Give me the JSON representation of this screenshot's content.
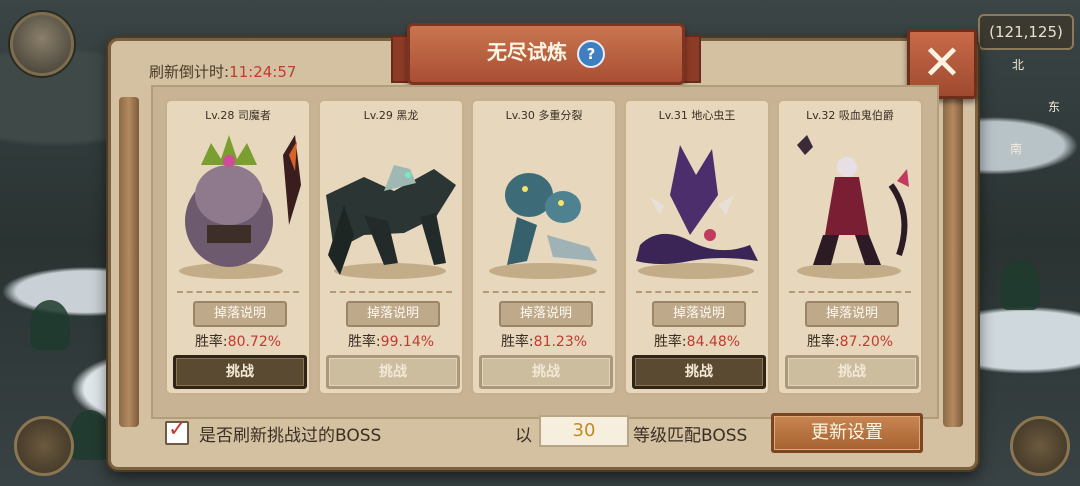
{
  "hud": {
    "coordinates": "(121,125)",
    "compass_north": "北",
    "compass_east": "东",
    "compass_south": "南"
  },
  "dialog": {
    "title": "无尽试炼",
    "help_icon": "?",
    "close_icon": "✕",
    "countdown_label": "刷新倒计时:",
    "countdown_value": "11:24:57"
  },
  "bosses": [
    {
      "level": "Lv.28",
      "name": "司魔者",
      "drop_label": "掉落说明",
      "winrate_label": "胜率:",
      "winrate": "80.72%",
      "challenge_label": "挑战",
      "enabled": true,
      "accent": "#7a9e2f"
    },
    {
      "level": "Lv.29",
      "name": "黑龙",
      "drop_label": "掉落说明",
      "winrate_label": "胜率:",
      "winrate": "99.14%",
      "challenge_label": "挑战",
      "enabled": false,
      "accent": "#2b3533"
    },
    {
      "level": "Lv.30",
      "name": "多重分裂",
      "drop_label": "掉落说明",
      "winrate_label": "胜率:",
      "winrate": "81.23%",
      "challenge_label": "挑战",
      "enabled": false,
      "accent": "#3e6b78"
    },
    {
      "level": "Lv.31",
      "name": "地心虫王",
      "drop_label": "掉落说明",
      "winrate_label": "胜率:",
      "winrate": "84.48%",
      "challenge_label": "挑战",
      "enabled": true,
      "accent": "#4b2e6b"
    },
    {
      "level": "Lv.32",
      "name": "吸血鬼伯爵",
      "drop_label": "掉落说明",
      "winrate_label": "胜率:",
      "winrate": "87.20%",
      "challenge_label": "挑战",
      "enabled": false,
      "accent": "#7a1f33"
    }
  ],
  "footer": {
    "refresh_checkbox_label": "是否刷新挑战过的BOSS",
    "refresh_checked": true,
    "level_prefix": "以",
    "level_value": "30",
    "level_suffix": "等级匹配BOSS",
    "update_button": "更新设置"
  }
}
